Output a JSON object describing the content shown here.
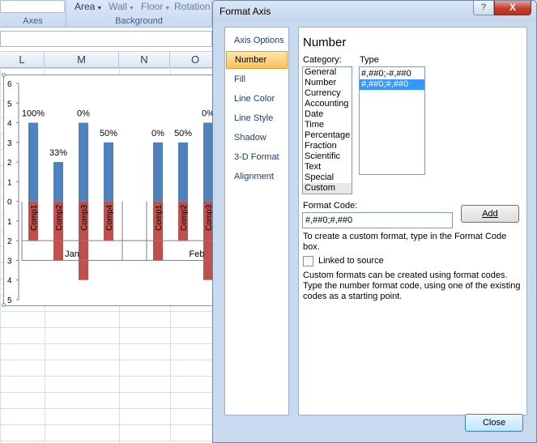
{
  "ribbon": {
    "groups": [
      {
        "name": "Axes"
      },
      {
        "name": "Background"
      }
    ],
    "buttons": [
      "Area",
      "Wall",
      "Floor",
      "Rotation"
    ]
  },
  "sheet": {
    "columns": [
      "L",
      "M",
      "N",
      "O"
    ]
  },
  "chart_data": {
    "type": "bar",
    "categories": [
      "Comp1",
      "Comp2",
      "Comp3",
      "Comp4",
      "Comp1",
      "Comp2",
      "Comp3"
    ],
    "groups": [
      "Jan",
      "Feb"
    ],
    "series": [
      {
        "values": [
          4,
          2,
          4,
          3,
          3,
          3,
          4
        ],
        "color": "#4f81bd"
      },
      {
        "values": [
          -2,
          -3,
          -4,
          -2,
          -3,
          -2,
          -4
        ],
        "color": "#c0504d"
      }
    ],
    "data_labels": [
      "100%",
      "33%",
      "0%",
      "50%",
      "0%",
      "50%",
      "0%"
    ],
    "y_tick_labels": [
      "6",
      "5",
      "4",
      "3",
      "2",
      "1",
      "0",
      "1",
      "2",
      "3",
      "4",
      "5"
    ],
    "ylim": [
      -5,
      6
    ]
  },
  "dialog": {
    "title": "Format Axis",
    "help_glyph": "?",
    "close_glyph": "X",
    "nav": [
      "Axis Options",
      "Number",
      "Fill",
      "Line Color",
      "Line Style",
      "Shadow",
      "3-D Format",
      "Alignment"
    ],
    "selected_nav": "Number",
    "panel_title": "Number",
    "category_label": "Category:",
    "categories": [
      "General",
      "Number",
      "Currency",
      "Accounting",
      "Date",
      "Time",
      "Percentage",
      "Fraction",
      "Scientific",
      "Text",
      "Special",
      "Custom"
    ],
    "selected_category": "Custom",
    "type_label": "Type",
    "types": [
      "#,##0;-#,##0",
      "#,##0;#,##0"
    ],
    "selected_type": "#,##0;#,##0",
    "format_code_label": "Format Code:",
    "format_code_value": "#,##0;#,##0",
    "add_button": "Add",
    "custom_hint": "To create a custom format, type in the Format Code box.",
    "linked_label": "Linked to source",
    "linked_checked": false,
    "info_text": "Custom formats can be created using format codes. Type the number format code, using one of the existing codes as a starting point.",
    "close_button": "Close"
  }
}
